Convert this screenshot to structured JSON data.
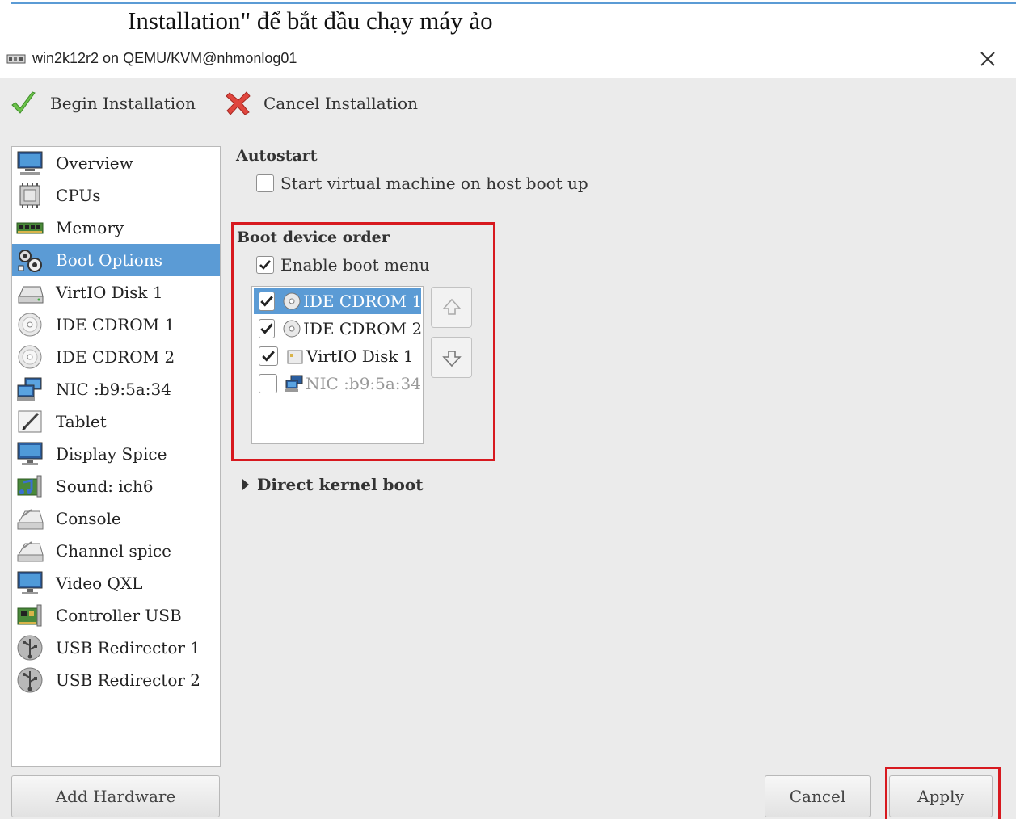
{
  "document": {
    "caption": "Installation\" để bắt đầu chạy máy ảo"
  },
  "window": {
    "title": "win2k12r2 on QEMU/KVM@nhmonlog01"
  },
  "toolbar": {
    "begin_label": "Begin Installation",
    "cancel_label": "Cancel Installation"
  },
  "sidebar": {
    "items": [
      {
        "label": "Overview",
        "icon": "monitor-icon"
      },
      {
        "label": "CPUs",
        "icon": "cpu-chip-icon"
      },
      {
        "label": "Memory",
        "icon": "memory-module-icon"
      },
      {
        "label": "Boot Options",
        "icon": "gears-icon",
        "selected": true
      },
      {
        "label": "VirtIO Disk 1",
        "icon": "hard-disk-icon"
      },
      {
        "label": "IDE CDROM 1",
        "icon": "cdrom-icon"
      },
      {
        "label": "IDE CDROM 2",
        "icon": "cdrom-icon"
      },
      {
        "label": "NIC :b9:5a:34",
        "icon": "network-icon"
      },
      {
        "label": "Tablet",
        "icon": "tablet-pen-icon"
      },
      {
        "label": "Display Spice",
        "icon": "display-icon"
      },
      {
        "label": "Sound: ich6",
        "icon": "sound-card-icon"
      },
      {
        "label": "Console",
        "icon": "serial-console-icon"
      },
      {
        "label": "Channel spice",
        "icon": "channel-icon"
      },
      {
        "label": "Video QXL",
        "icon": "video-icon"
      },
      {
        "label": "Controller USB",
        "icon": "controller-card-icon"
      },
      {
        "label": "USB Redirector 1",
        "icon": "usb-icon"
      },
      {
        "label": "USB Redirector 2",
        "icon": "usb-icon"
      }
    ]
  },
  "autostart": {
    "title": "Autostart",
    "checkbox_label": "Start virtual machine on host boot up",
    "checked": false
  },
  "boot": {
    "title": "Boot device order",
    "enable_menu_label": "Enable boot menu",
    "enable_menu_checked": true,
    "devices": [
      {
        "label": "IDE CDROM 1",
        "checked": true,
        "selected": true,
        "icon": "cdrom-icon"
      },
      {
        "label": "IDE CDROM 2",
        "checked": true,
        "selected": false,
        "icon": "cdrom-icon"
      },
      {
        "label": "VirtIO Disk 1",
        "checked": true,
        "selected": false,
        "icon": "hard-disk-icon"
      },
      {
        "label": "NIC :b9:5a:34",
        "checked": false,
        "selected": false,
        "disabled": true,
        "icon": "network-icon"
      }
    ]
  },
  "kernel": {
    "label": "Direct kernel boot"
  },
  "buttons": {
    "add_hardware": "Add Hardware",
    "cancel": "Cancel",
    "apply": "Apply"
  },
  "colors": {
    "selection": "#5b9bd5",
    "highlight_frame": "#d7191f",
    "window_bg": "#ebebeb"
  }
}
